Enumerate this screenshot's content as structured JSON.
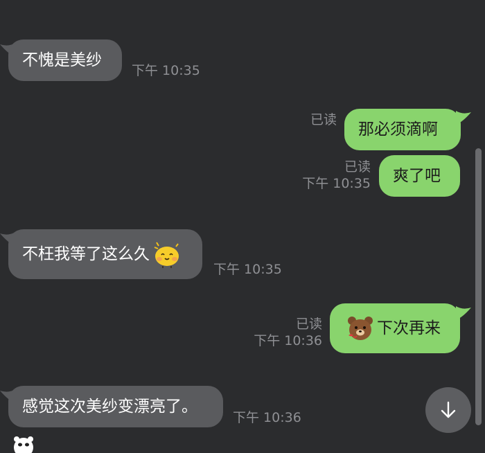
{
  "messages": [
    {
      "side": "in",
      "text": "不愧是美纱",
      "time": "下午 10:35"
    },
    {
      "side": "out",
      "text": "那必须滴啊",
      "read": "已读"
    },
    {
      "side": "out",
      "text": "爽了吧",
      "read": "已读",
      "time": "下午 10:35"
    },
    {
      "side": "in",
      "text": "不枉我等了这么久",
      "time": "下午 10:35",
      "emoji": "smiling-blob-emoji"
    },
    {
      "side": "out",
      "text": "下次再来",
      "read": "已读",
      "time": "下午 10:36",
      "emoji": "brown-bear-emoji"
    },
    {
      "side": "in",
      "text": "感觉这次美纱变漂亮了。",
      "time": "下午 10:36"
    }
  ],
  "colors": {
    "background": "#2b2c2e",
    "incoming_bubble": "#5a5b5e",
    "outgoing_bubble": "#89d46d",
    "meta_text": "#8f9094"
  },
  "controls": {
    "scroll_down_icon": "arrow-down-icon"
  }
}
